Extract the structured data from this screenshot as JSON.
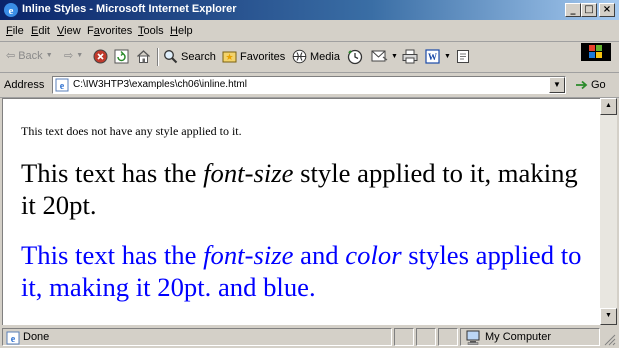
{
  "window": {
    "title": "Inline Styles - Microsoft Internet Explorer",
    "controls": {
      "minimize": "_",
      "maximize": "□",
      "close": "×"
    }
  },
  "menu": [
    {
      "label": "File",
      "mnemonic": "F"
    },
    {
      "label": "Edit",
      "mnemonic": "E"
    },
    {
      "label": "View",
      "mnemonic": "V"
    },
    {
      "label": "Favorites",
      "mnemonic": "a"
    },
    {
      "label": "Tools",
      "mnemonic": "T"
    },
    {
      "label": "Help",
      "mnemonic": "H"
    }
  ],
  "toolbar": {
    "back": "Back",
    "search": "Search",
    "favorites": "Favorites",
    "media": "Media"
  },
  "address": {
    "label": "Address",
    "url": "C:\\IW3HTP3\\examples\\ch06\\inline.html",
    "go": "Go"
  },
  "content": {
    "p1": "This text does not have any style applied to it.",
    "p2": {
      "before": "This text has the ",
      "em": "font-size",
      "after": " style applied to it, making it 20pt."
    },
    "p3": {
      "before": "This text has the ",
      "em1": "font-size",
      "mid": " and ",
      "em2": "color",
      "after": " styles applied to it, making it 20pt. and blue."
    }
  },
  "status": {
    "text": "Done",
    "zone": "My Computer"
  },
  "colors": {
    "titlebar": "#0a246a",
    "chrome": "#d4d0c8",
    "blue_text": "#0000ff"
  }
}
